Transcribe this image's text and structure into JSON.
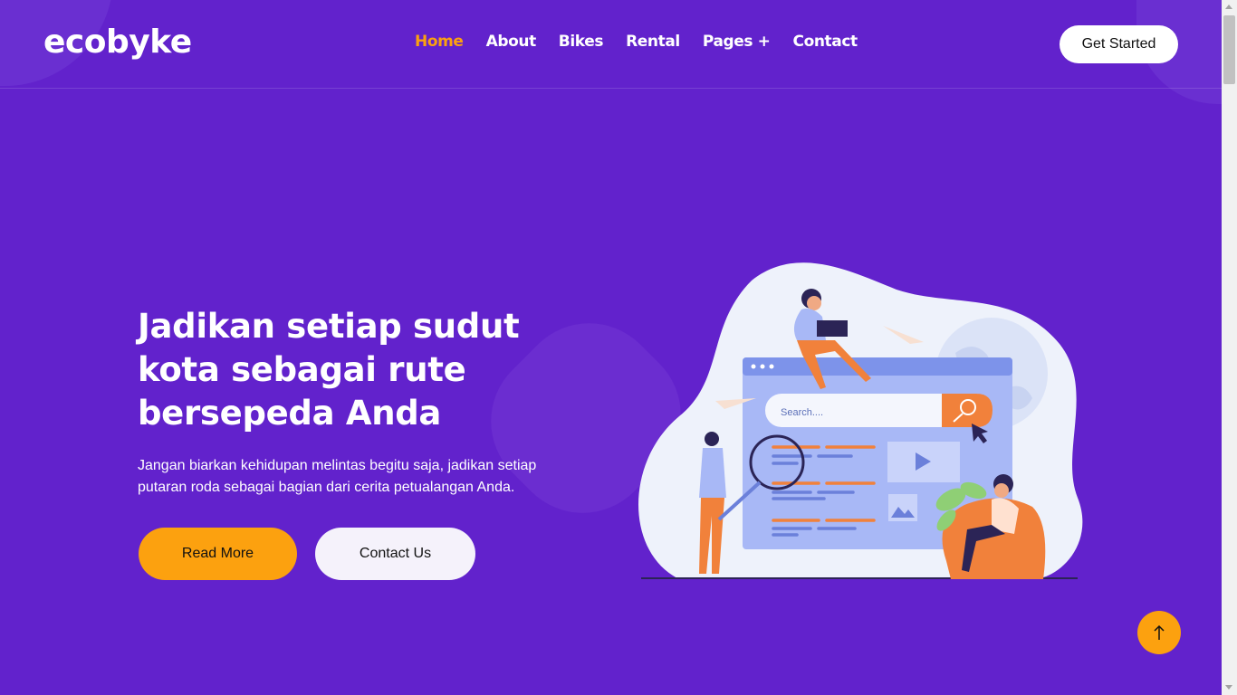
{
  "brand": {
    "logo": "ecobyke"
  },
  "nav": {
    "items": [
      {
        "label": "Home",
        "active": true
      },
      {
        "label": "About"
      },
      {
        "label": "Bikes"
      },
      {
        "label": "Rental"
      },
      {
        "label": "Pages +"
      },
      {
        "label": "Contact"
      }
    ]
  },
  "header": {
    "cta_label": "Get Started"
  },
  "hero": {
    "title": "Jadikan setiap sudut kota sebagai rute bersepeda Anda",
    "text": "Jangan biarkan kehidupan melintas begitu saja, jadikan setiap putaran roda sebagai bagian dari cerita petualangan Anda.",
    "read_more_label": "Read More",
    "contact_label": "Contact Us"
  },
  "illustration": {
    "search_placeholder": "Search....",
    "icons": [
      "magnifier-icon",
      "play-icon",
      "image-icon",
      "cursor-icon"
    ]
  },
  "scroll_top": {
    "icon": "arrow-up-icon"
  },
  "colors": {
    "background": "#6222cc",
    "accent": "#fca10f",
    "white": "#ffffff"
  }
}
